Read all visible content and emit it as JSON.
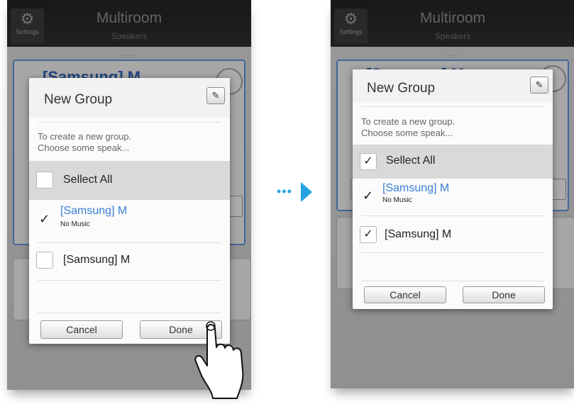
{
  "app": {
    "title": "Multiroom",
    "subtitle": "Speakers",
    "settings_label": "Settings",
    "background_speaker": "[Samsung] M"
  },
  "before": {
    "dialog_title": "New Group",
    "description": "To create a new group.\nChoose some speak...",
    "select_all": {
      "label": "Sellect All",
      "checked": false
    },
    "items": [
      {
        "name": "[Samsung] M",
        "status": "No Music",
        "checked": true,
        "current": true
      },
      {
        "name": "[Samsung] M",
        "checked": false
      }
    ],
    "cancel_label": "Cancel",
    "done_label": "Done"
  },
  "after": {
    "dialog_title": "New Group",
    "description": "To create a new group.\nChoose some speak...",
    "select_all": {
      "label": "Sellect All",
      "checked": true
    },
    "items": [
      {
        "name": "[Samsung] M",
        "status": "No Music",
        "checked": true,
        "current": true
      },
      {
        "name": "[Samsung] M",
        "checked": true
      }
    ],
    "cancel_label": "Cancel",
    "done_label": "Done"
  },
  "icons": {
    "settings": "gear-icon",
    "edit": "pencil-icon",
    "check": "checkmark-icon",
    "arrow": "arrow-right-icon",
    "hand": "pointing-hand-icon"
  },
  "colors": {
    "accent_blue": "#3a80d6",
    "arrow_blue": "#27a3e3",
    "select_row_bg": "#d9d9d9"
  }
}
